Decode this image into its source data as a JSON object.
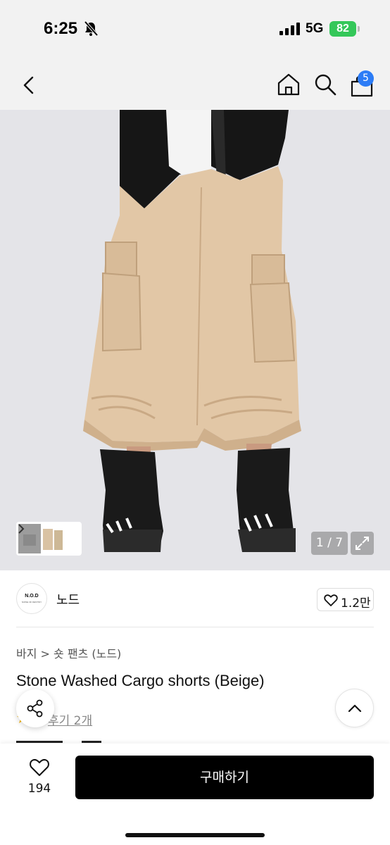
{
  "status_bar": {
    "time": "6:25",
    "network": "5G",
    "battery": "82"
  },
  "nav": {
    "cart_count": "5"
  },
  "gallery": {
    "counter": "1 / 7"
  },
  "brand": {
    "logo_text": "N.O.D",
    "logo_subtext": "NOISE OF DESTINY",
    "name": "노드",
    "likes": "1.2만"
  },
  "product": {
    "breadcrumb": [
      "바지",
      "숏 팬츠 (노드)"
    ],
    "title": "Stone Washed Cargo shorts (Beige)",
    "review_link": "후기 2개",
    "review_link_visible": "후기 2개"
  },
  "bottom_bar": {
    "wish_count": "194",
    "buy_label": "구매하기"
  },
  "colors": {
    "accent_blue": "#2c7cf6",
    "battery_green": "#34c759",
    "buy_button": "#000000"
  }
}
